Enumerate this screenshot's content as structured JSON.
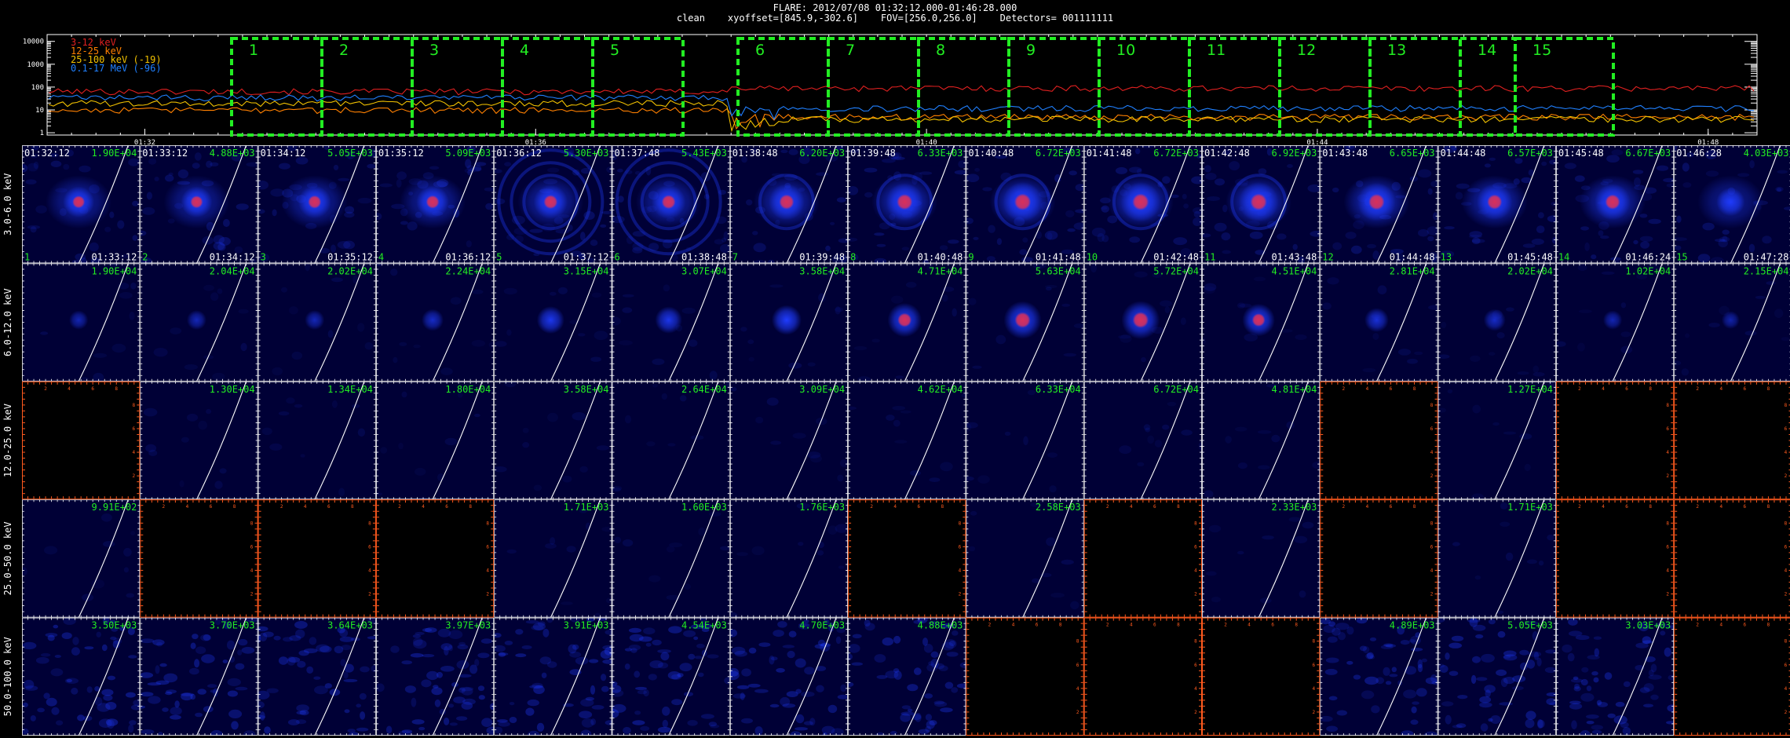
{
  "header": {
    "line1": "FLARE: 2012/07/08 01:32:12.000-01:46:28.000",
    "line2": "clean    xyoffset=[845.9,-302.6]    FOV=[256.0,256.0]    Detectors= 001111111"
  },
  "chart_data": [
    {
      "type": "line",
      "yscale": "log",
      "yticks": [
        "10000",
        "1000",
        "100",
        "10",
        "1"
      ],
      "xticks": [
        "01:32",
        "01:36",
        "01:40",
        "01:44",
        "01:48"
      ],
      "legend": [
        {
          "label": "3-12 keV",
          "color": "#e02020"
        },
        {
          "label": "12-25 keV",
          "color": "#ff8000"
        },
        {
          "label": "25-100 keV (-19)",
          "color": "#f0c000"
        },
        {
          "label": "0.1-17 MeV (-96)",
          "color": "#2080ff"
        }
      ],
      "series_levels": [
        {
          "name": "3-12 keV",
          "before": 65,
          "after": 90,
          "step_interval": 6
        },
        {
          "name": "12-25 keV",
          "before": 10,
          "after": 5,
          "step_interval": 6
        },
        {
          "name": "25-100 keV (-19)",
          "before": 20,
          "after": 4,
          "step_interval": 6
        },
        {
          "name": "0.1-17 MeV (-96)",
          "before": 35,
          "after": 12,
          "step_interval": 6
        }
      ],
      "intervals": [
        "1",
        "2",
        "3",
        "4",
        "5",
        "6",
        "7",
        "8",
        "9",
        "10",
        "11",
        "12",
        "13",
        "14",
        "15"
      ],
      "interval_color": "#22ee22"
    },
    {
      "type": "heatmap",
      "rows": [
        "3.0-6.0 keV",
        "6.0-12.0 keV",
        "12.0-25.0 keV",
        "25.0-50.0 keV",
        "50.0-100.0 keV"
      ],
      "start_times": [
        "01:32:12",
        "01:33:12",
        "01:34:12",
        "01:35:12",
        "01:36:12",
        "01:37:48",
        "01:38:48",
        "01:39:48",
        "01:40:48",
        "01:41:48",
        "01:42:48",
        "01:43:48",
        "01:44:48",
        "01:45:48",
        "01:46:28"
      ],
      "end_times": [
        "01:33:12",
        "01:34:12",
        "01:35:12",
        "01:36:12",
        "01:37:12",
        "01:38:48",
        "01:39:48",
        "01:40:48",
        "01:41:48",
        "01:42:48",
        "01:43:48",
        "01:44:48",
        "01:45:48",
        "01:46:24",
        "01:47:28"
      ],
      "peaks": [
        [
          "1.90E+04",
          "4.88E+03",
          "5.05E+03",
          "5.09E+03",
          "5.30E+03",
          "5.43E+03",
          "6.20E+03",
          "6.33E+03",
          "6.72E+03",
          "6.72E+03",
          "6.92E+03",
          "6.65E+03",
          "6.57E+03",
          "6.67E+03",
          "4.03E+03"
        ],
        [
          "1.90E+04",
          "2.04E+04",
          "2.02E+04",
          "2.24E+04",
          "3.15E+04",
          "3.07E+04",
          "3.58E+04",
          "4.71E+04",
          "5.63E+04",
          "5.72E+04",
          "4.51E+04",
          "2.81E+04",
          "2.02E+04",
          "1.02E+04",
          "2.15E+04"
        ],
        [
          "",
          "1.30E+04",
          "1.34E+04",
          "1.80E+04",
          "3.58E+04",
          "2.64E+04",
          "3.09E+04",
          "4.62E+04",
          "6.33E+04",
          "6.72E+04",
          "4.81E+04",
          "",
          "1.27E+04",
          "",
          ""
        ],
        [
          "9.91E+02",
          "",
          "",
          "",
          "1.71E+03",
          "1.60E+03",
          "1.76E+03",
          "",
          "2.58E+03",
          "",
          "2.33E+03",
          "",
          "1.71E+03",
          "",
          ""
        ],
        [
          "3.50E+03",
          "3.70E+03",
          "3.64E+03",
          "3.97E+03",
          "3.91E+03",
          "4.54E+03",
          "4.70E+03",
          "4.88E+03",
          "",
          "",
          "",
          "4.89E+03",
          "5.05E+03",
          "3.03E+03",
          ""
        ]
      ],
      "empty_tick_labels": [
        "2",
        "4",
        "6",
        "8"
      ],
      "source_intensity": [
        [
          0.55,
          0.55,
          0.6,
          0.6,
          0.65,
          0.65,
          0.72,
          0.78,
          0.85,
          0.85,
          0.85,
          0.8,
          0.72,
          0.72,
          0.45
        ],
        [
          0.12,
          0.14,
          0.14,
          0.22,
          0.42,
          0.4,
          0.5,
          0.65,
          0.78,
          0.8,
          0.6,
          0.3,
          0.22,
          0.12,
          0.08
        ],
        [
          0,
          0,
          0,
          0,
          0,
          0,
          0,
          0,
          0,
          0,
          0,
          0,
          0,
          0,
          0
        ],
        [
          0,
          0,
          0,
          0,
          0,
          0,
          0,
          0,
          0,
          0,
          0,
          0,
          0,
          0,
          0
        ],
        [
          0,
          0,
          0,
          0,
          0,
          0,
          0,
          0,
          0,
          0,
          0,
          0,
          0,
          0,
          0
        ]
      ],
      "rings": [
        0,
        0,
        0,
        0,
        3,
        3,
        1,
        1,
        1,
        1,
        1,
        0,
        0,
        0,
        0
      ],
      "colors": {
        "background": "#000036",
        "source": "#1f3cff",
        "core": "#d8305a",
        "limb": "#ffffff",
        "peak_label": "#22ee22",
        "time_label": "#ffffff",
        "empty_axis": "#ff5a1e"
      }
    }
  ]
}
